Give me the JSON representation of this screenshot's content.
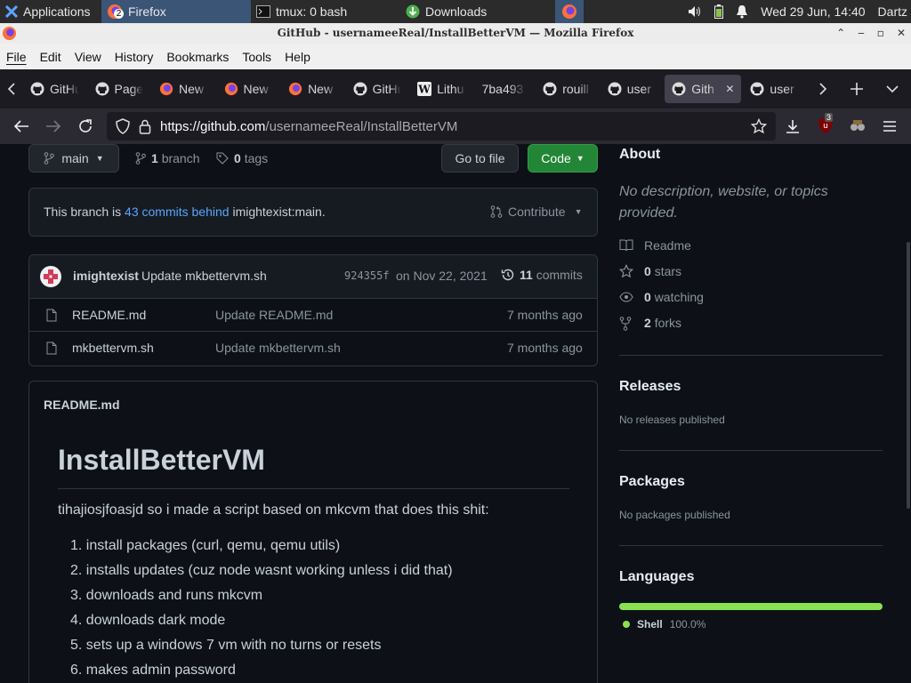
{
  "panel": {
    "applications": "Applications",
    "firefox_task": "Firefox",
    "firefox_badge": "2",
    "tmux_task": "tmux: 0 bash",
    "downloads_task": "Downloads",
    "datetime": "Wed 29 Jun, 14:40",
    "user": "Dartz"
  },
  "window": {
    "title": "GitHub - usernameeReal/InstallBetterVM — Mozilla Firefox"
  },
  "menu": [
    "File",
    "Edit",
    "View",
    "History",
    "Bookmarks",
    "Tools",
    "Help"
  ],
  "tabs": [
    {
      "label": "GitHu",
      "icon": "github-icon"
    },
    {
      "label": "Page",
      "icon": "github-icon"
    },
    {
      "label": "New",
      "icon": "firefox-icon"
    },
    {
      "label": "New",
      "icon": "firefox-icon"
    },
    {
      "label": "New",
      "icon": "firefox-icon"
    },
    {
      "label": "GitHu",
      "icon": "github-icon"
    },
    {
      "label": "Lithu",
      "icon": "wikipedia-icon"
    },
    {
      "label": "7ba493",
      "icon": "none"
    },
    {
      "label": "rouill",
      "icon": "github-icon"
    },
    {
      "label": "user",
      "icon": "github-icon"
    },
    {
      "label": "Gith",
      "icon": "github-icon",
      "selected": true
    },
    {
      "label": "user",
      "icon": "github-icon"
    }
  ],
  "nav": {
    "url_host": "https://github.com",
    "url_path": "/usernameeReal/InstallBetterVM",
    "ublock_count": "3"
  },
  "repo": {
    "branch": "main",
    "branch_count": "1",
    "branch_word": "branch",
    "tag_count": "0",
    "tag_word": "tags",
    "go_to_file": "Go to file",
    "code": "Code",
    "behind_prefix": "This branch is",
    "behind_link": "43 commits behind",
    "behind_suffix": "imightexist:main.",
    "contribute": "Contribute",
    "commit_author": "imightexist",
    "commit_message": "Update mkbettervm.sh",
    "commit_sha": "924355f",
    "commit_date": "on Nov 22, 2021",
    "commits_count": "11",
    "commits_word": "commits",
    "files": [
      {
        "name": "README.md",
        "message": "Update README.md",
        "age": "7 months ago"
      },
      {
        "name": "mkbettervm.sh",
        "message": "Update mkbettervm.sh",
        "age": "7 months ago"
      }
    ],
    "readme_label": "README.md",
    "readme_title": "InstallBetterVM",
    "readme_intro": "tihajiosjfoasjd so i made a script based on mkcvm that does this shit:",
    "readme_items": [
      "1. install packages (curl, qemu, qemu utils)",
      "2. installs updates (cuz node wasnt working unless i did that)",
      "3. downloads and runs mkcvm",
      "4. downloads dark mode",
      "5. sets up a windows 7 vm with no turns or resets",
      "6. makes admin password"
    ]
  },
  "sidebar": {
    "about": "About",
    "description": "No description, website, or topics provided.",
    "readme": "Readme",
    "stars_count": "0",
    "stars_word": "stars",
    "watching_count": "0",
    "watching_word": "watching",
    "forks_count": "2",
    "forks_word": "forks",
    "releases": "Releases",
    "no_releases": "No releases published",
    "packages": "Packages",
    "no_packages": "No packages published",
    "languages": "Languages",
    "language_name": "Shell",
    "language_percent": "100.0%",
    "language_color": "#89e051"
  }
}
